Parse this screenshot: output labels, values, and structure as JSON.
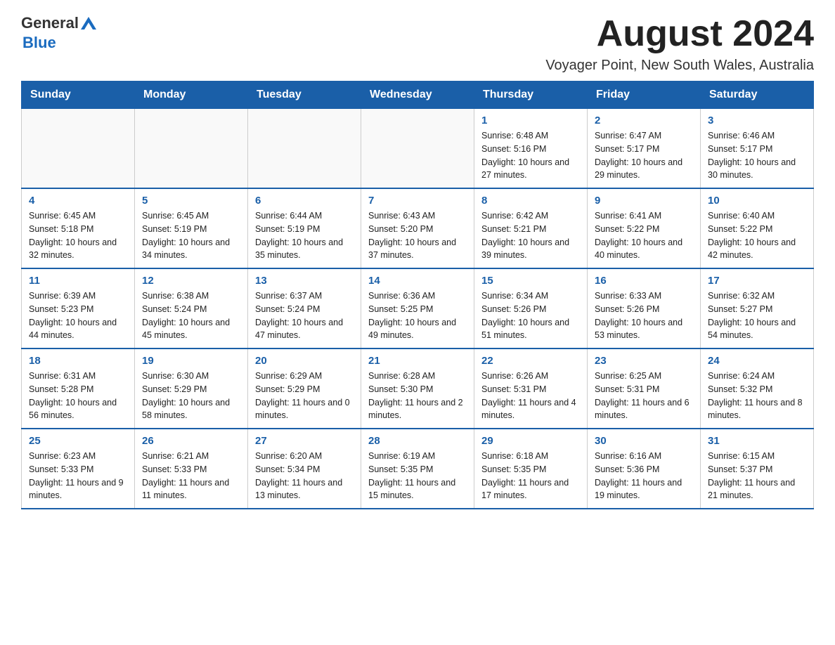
{
  "header": {
    "logo": {
      "general": "General",
      "blue": "Blue"
    },
    "month_title": "August 2024",
    "location": "Voyager Point, New South Wales, Australia"
  },
  "days_of_week": [
    "Sunday",
    "Monday",
    "Tuesday",
    "Wednesday",
    "Thursday",
    "Friday",
    "Saturday"
  ],
  "weeks": [
    {
      "days": [
        {
          "num": "",
          "sunrise": "",
          "sunset": "",
          "daylight": ""
        },
        {
          "num": "",
          "sunrise": "",
          "sunset": "",
          "daylight": ""
        },
        {
          "num": "",
          "sunrise": "",
          "sunset": "",
          "daylight": ""
        },
        {
          "num": "",
          "sunrise": "",
          "sunset": "",
          "daylight": ""
        },
        {
          "num": "1",
          "sunrise": "Sunrise: 6:48 AM",
          "sunset": "Sunset: 5:16 PM",
          "daylight": "Daylight: 10 hours and 27 minutes."
        },
        {
          "num": "2",
          "sunrise": "Sunrise: 6:47 AM",
          "sunset": "Sunset: 5:17 PM",
          "daylight": "Daylight: 10 hours and 29 minutes."
        },
        {
          "num": "3",
          "sunrise": "Sunrise: 6:46 AM",
          "sunset": "Sunset: 5:17 PM",
          "daylight": "Daylight: 10 hours and 30 minutes."
        }
      ]
    },
    {
      "days": [
        {
          "num": "4",
          "sunrise": "Sunrise: 6:45 AM",
          "sunset": "Sunset: 5:18 PM",
          "daylight": "Daylight: 10 hours and 32 minutes."
        },
        {
          "num": "5",
          "sunrise": "Sunrise: 6:45 AM",
          "sunset": "Sunset: 5:19 PM",
          "daylight": "Daylight: 10 hours and 34 minutes."
        },
        {
          "num": "6",
          "sunrise": "Sunrise: 6:44 AM",
          "sunset": "Sunset: 5:19 PM",
          "daylight": "Daylight: 10 hours and 35 minutes."
        },
        {
          "num": "7",
          "sunrise": "Sunrise: 6:43 AM",
          "sunset": "Sunset: 5:20 PM",
          "daylight": "Daylight: 10 hours and 37 minutes."
        },
        {
          "num": "8",
          "sunrise": "Sunrise: 6:42 AM",
          "sunset": "Sunset: 5:21 PM",
          "daylight": "Daylight: 10 hours and 39 minutes."
        },
        {
          "num": "9",
          "sunrise": "Sunrise: 6:41 AM",
          "sunset": "Sunset: 5:22 PM",
          "daylight": "Daylight: 10 hours and 40 minutes."
        },
        {
          "num": "10",
          "sunrise": "Sunrise: 6:40 AM",
          "sunset": "Sunset: 5:22 PM",
          "daylight": "Daylight: 10 hours and 42 minutes."
        }
      ]
    },
    {
      "days": [
        {
          "num": "11",
          "sunrise": "Sunrise: 6:39 AM",
          "sunset": "Sunset: 5:23 PM",
          "daylight": "Daylight: 10 hours and 44 minutes."
        },
        {
          "num": "12",
          "sunrise": "Sunrise: 6:38 AM",
          "sunset": "Sunset: 5:24 PM",
          "daylight": "Daylight: 10 hours and 45 minutes."
        },
        {
          "num": "13",
          "sunrise": "Sunrise: 6:37 AM",
          "sunset": "Sunset: 5:24 PM",
          "daylight": "Daylight: 10 hours and 47 minutes."
        },
        {
          "num": "14",
          "sunrise": "Sunrise: 6:36 AM",
          "sunset": "Sunset: 5:25 PM",
          "daylight": "Daylight: 10 hours and 49 minutes."
        },
        {
          "num": "15",
          "sunrise": "Sunrise: 6:34 AM",
          "sunset": "Sunset: 5:26 PM",
          "daylight": "Daylight: 10 hours and 51 minutes."
        },
        {
          "num": "16",
          "sunrise": "Sunrise: 6:33 AM",
          "sunset": "Sunset: 5:26 PM",
          "daylight": "Daylight: 10 hours and 53 minutes."
        },
        {
          "num": "17",
          "sunrise": "Sunrise: 6:32 AM",
          "sunset": "Sunset: 5:27 PM",
          "daylight": "Daylight: 10 hours and 54 minutes."
        }
      ]
    },
    {
      "days": [
        {
          "num": "18",
          "sunrise": "Sunrise: 6:31 AM",
          "sunset": "Sunset: 5:28 PM",
          "daylight": "Daylight: 10 hours and 56 minutes."
        },
        {
          "num": "19",
          "sunrise": "Sunrise: 6:30 AM",
          "sunset": "Sunset: 5:29 PM",
          "daylight": "Daylight: 10 hours and 58 minutes."
        },
        {
          "num": "20",
          "sunrise": "Sunrise: 6:29 AM",
          "sunset": "Sunset: 5:29 PM",
          "daylight": "Daylight: 11 hours and 0 minutes."
        },
        {
          "num": "21",
          "sunrise": "Sunrise: 6:28 AM",
          "sunset": "Sunset: 5:30 PM",
          "daylight": "Daylight: 11 hours and 2 minutes."
        },
        {
          "num": "22",
          "sunrise": "Sunrise: 6:26 AM",
          "sunset": "Sunset: 5:31 PM",
          "daylight": "Daylight: 11 hours and 4 minutes."
        },
        {
          "num": "23",
          "sunrise": "Sunrise: 6:25 AM",
          "sunset": "Sunset: 5:31 PM",
          "daylight": "Daylight: 11 hours and 6 minutes."
        },
        {
          "num": "24",
          "sunrise": "Sunrise: 6:24 AM",
          "sunset": "Sunset: 5:32 PM",
          "daylight": "Daylight: 11 hours and 8 minutes."
        }
      ]
    },
    {
      "days": [
        {
          "num": "25",
          "sunrise": "Sunrise: 6:23 AM",
          "sunset": "Sunset: 5:33 PM",
          "daylight": "Daylight: 11 hours and 9 minutes."
        },
        {
          "num": "26",
          "sunrise": "Sunrise: 6:21 AM",
          "sunset": "Sunset: 5:33 PM",
          "daylight": "Daylight: 11 hours and 11 minutes."
        },
        {
          "num": "27",
          "sunrise": "Sunrise: 6:20 AM",
          "sunset": "Sunset: 5:34 PM",
          "daylight": "Daylight: 11 hours and 13 minutes."
        },
        {
          "num": "28",
          "sunrise": "Sunrise: 6:19 AM",
          "sunset": "Sunset: 5:35 PM",
          "daylight": "Daylight: 11 hours and 15 minutes."
        },
        {
          "num": "29",
          "sunrise": "Sunrise: 6:18 AM",
          "sunset": "Sunset: 5:35 PM",
          "daylight": "Daylight: 11 hours and 17 minutes."
        },
        {
          "num": "30",
          "sunrise": "Sunrise: 6:16 AM",
          "sunset": "Sunset: 5:36 PM",
          "daylight": "Daylight: 11 hours and 19 minutes."
        },
        {
          "num": "31",
          "sunrise": "Sunrise: 6:15 AM",
          "sunset": "Sunset: 5:37 PM",
          "daylight": "Daylight: 11 hours and 21 minutes."
        }
      ]
    }
  ]
}
